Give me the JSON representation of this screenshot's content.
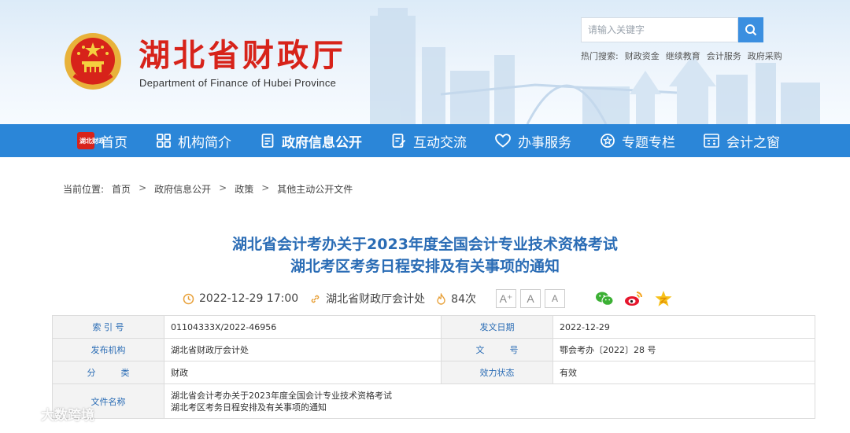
{
  "header": {
    "site_name": "湖北省财政厅",
    "site_subtitle": "Department of Finance of Hubei Province",
    "search": {
      "placeholder": "请输入关键字"
    },
    "hot_label": "热门搜索:",
    "hot_links": [
      "财政资金",
      "继续教育",
      "会计服务",
      "政府采购"
    ]
  },
  "nav": {
    "home_badge": "湖北财政",
    "items": [
      "首页",
      "机构简介",
      "政府信息公开",
      "互动交流",
      "办事服务",
      "专题专栏",
      "会计之窗"
    ],
    "active": "政府信息公开"
  },
  "breadcrumb": {
    "label": "当前位置:",
    "items": [
      "首页",
      "政府信息公开",
      "政策",
      "其他主动公开文件"
    ],
    "separator": ">"
  },
  "article": {
    "title_line1": "湖北省会计考办关于2023年度全国会计专业技术资格考试",
    "title_line2": "湖北考区考务日程安排及有关事项的通知",
    "datetime": "2022-12-29 17:00",
    "source": "湖北省财政厅会计处",
    "views": "84次",
    "font_buttons": [
      "A⁺",
      "A",
      "A"
    ]
  },
  "info_table": {
    "index_label": "索 引 号",
    "index_value": "01104333X/2022-46956",
    "date_label": "发文日期",
    "date_value": "2022-12-29",
    "publisher_label": "发布机构",
    "publisher_value": "湖北省财政厅会计处",
    "docno_label_a": "文",
    "docno_label_b": "号",
    "docno_value": "鄂会考办〔2022〕28 号",
    "category_label_a": "分",
    "category_label_b": "类",
    "category_value": "财政",
    "status_label": "效力状态",
    "status_value": "有效",
    "filename_label": "文件名称",
    "filename_line1": "湖北省会计考办关于2023年度全国会计专业技术资格考试",
    "filename_line2": "湖北考区考务日程安排及有关事项的通知"
  },
  "watermark": "大数跨境",
  "colors": {
    "brand_red": "#d7231a",
    "nav_blue": "#2b86d8",
    "title_blue": "#2a6cb5"
  }
}
